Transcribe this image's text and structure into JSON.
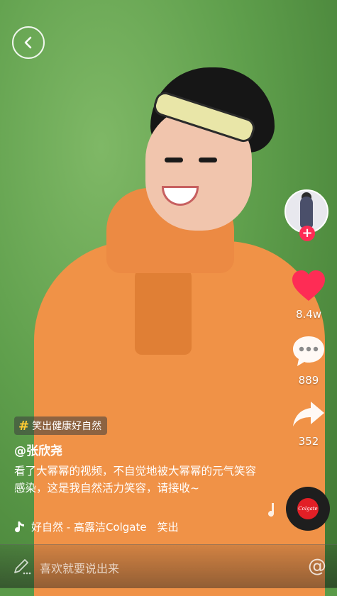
{
  "video": {
    "hashtag": "笑出健康好自然",
    "username": "@张欣尧",
    "description": "看了大幂幂的视频，不自觉地被大幂幂的元气笑容感染，这是我自然活力笑容，请接收~",
    "music_text": "好自然 - 高露洁Colgate　笑出"
  },
  "actions": {
    "like_count": "8.4w",
    "comment_count": "889",
    "share_count": "352"
  },
  "disc_label": "Colgate",
  "comment_bar": {
    "placeholder": "喜欢就要说出来",
    "at_symbol": "@"
  },
  "icons": {
    "back": "chevron-left-icon",
    "like": "heart-icon",
    "comment": "speech-bubble-icon",
    "share": "share-arrow-icon",
    "music_note": "music-note-icon",
    "pencil": "pencil-icon",
    "follow": "plus-icon"
  },
  "colors": {
    "like_red": "#fe2c55",
    "hashtag_yellow": "#ffcc33",
    "disc_red": "#e21f26"
  }
}
